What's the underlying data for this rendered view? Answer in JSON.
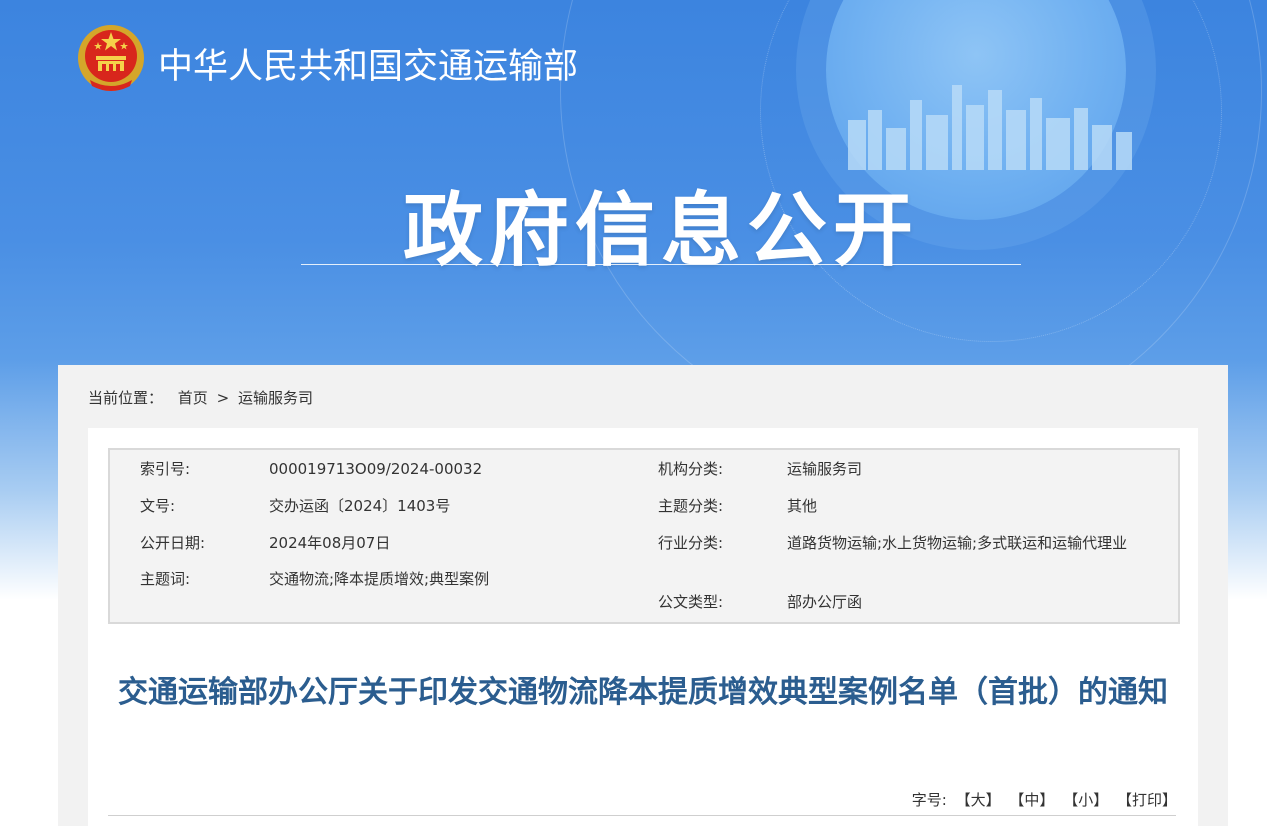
{
  "header": {
    "ministry_name": "中华人民共和国交通运输部",
    "section_title": "政府信息公开",
    "emblem_icon": "national-emblem-icon"
  },
  "breadcrumb": {
    "label": "当前位置：",
    "home": "首页",
    "separator": ">",
    "current": "运输服务司"
  },
  "meta": {
    "index_no_label": "索引号:",
    "index_no": "000019713O09/2024-00032",
    "doc_no_label": "文号:",
    "doc_no": "交办运函〔2024〕1403号",
    "date_label": "公开日期:",
    "date": "2024年08月07日",
    "keywords_label": "主题词:",
    "keywords": "交通物流;降本提质增效;典型案例",
    "org_label": "机构分类:",
    "org": "运输服务司",
    "topic_label": "主题分类:",
    "topic": "其他",
    "industry_label": "行业分类:",
    "industry": "道路货物运输;水上货物运输;多式联运和运输代理业",
    "doctype_label": "公文类型:",
    "doctype": "部办公厅函"
  },
  "document": {
    "title": "交通运输部办公厅关于印发交通物流降本提质增效典型案例名单（首批）的通知"
  },
  "font_size_control": {
    "label": "字号:",
    "large": "【大】",
    "medium": "【中】",
    "small": "【小】",
    "print": "【打印】"
  },
  "colors": {
    "hero_blue": "#3c84df",
    "title_blue": "#2b5d8f"
  }
}
